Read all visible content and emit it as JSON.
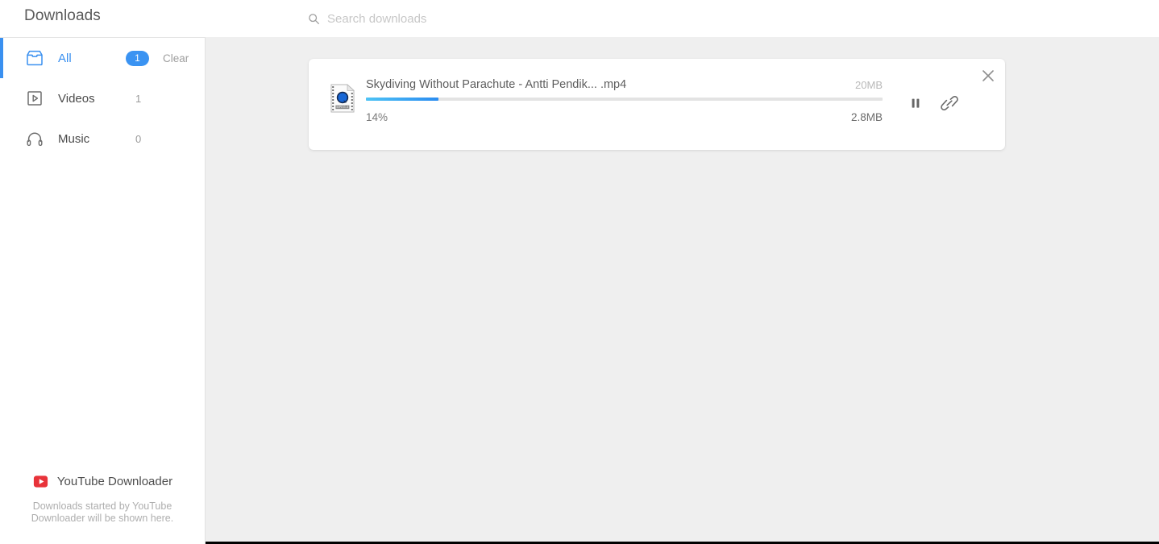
{
  "window": {
    "title": "Downloads"
  },
  "search": {
    "icon": "search-icon",
    "value": "",
    "placeholder": "Search downloads"
  },
  "sidebar": {
    "items": [
      {
        "id": "all",
        "icon": "inbox-icon",
        "label": "All",
        "badge": "1",
        "count": null,
        "action_label": "Clear",
        "active": true
      },
      {
        "id": "videos",
        "icon": "video-play-icon",
        "label": "Videos",
        "badge": null,
        "count": "1",
        "action_label": null,
        "active": false
      },
      {
        "id": "music",
        "icon": "headphones-icon",
        "label": "Music",
        "badge": null,
        "count": "0",
        "action_label": null,
        "active": false
      }
    ],
    "footer": {
      "brand_icon": "youtube-icon",
      "brand_name": "YouTube Downloader",
      "note": "Downloads started by YouTube Downloader will be shown here."
    }
  },
  "downloads": [
    {
      "file_icon": "mpeg4-file-icon",
      "file_icon_label": "MPEG-4",
      "name": "Skydiving Without Parachute - Antti Pendik... .mp4",
      "total_size": "20MB",
      "percent_label": "14%",
      "percent_value": 14,
      "downloaded_size": "2.8MB",
      "actions": {
        "pause": "pause-icon",
        "link": "link-icon",
        "close": "close-icon"
      }
    }
  ],
  "colors": {
    "accent_blue": "#3a90f0",
    "badge_blue": "#3a93f2",
    "progress_start": "#4ec3f5",
    "progress_end": "#2b8cf0",
    "page_bg": "#efefef",
    "panel_bg": "#ffffff",
    "brand_red": "#e8333a"
  }
}
